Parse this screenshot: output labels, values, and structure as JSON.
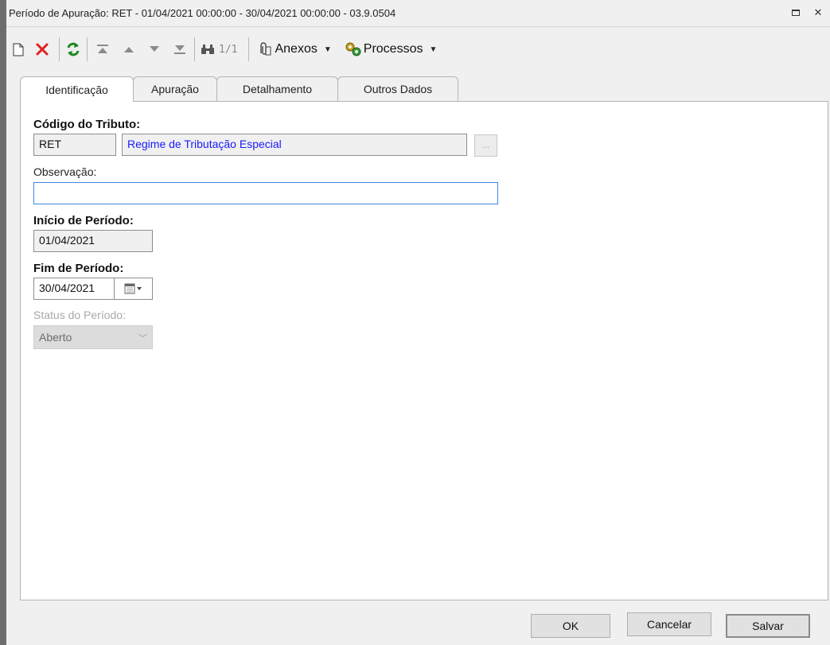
{
  "window": {
    "title": "Período de Apuração: RET - 01/04/2021 00:00:00 - 30/04/2021 00:00:00 - 03.9.0504"
  },
  "toolbar": {
    "new_icon": "new-document-icon",
    "delete_icon": "delete-icon",
    "refresh_icon": "refresh-icon",
    "counter": "1/1",
    "anexos_label": "Anexos",
    "processos_label": "Processos"
  },
  "tabs": [
    {
      "label": "Identificação",
      "active": true
    },
    {
      "label": "Apuração",
      "active": false
    },
    {
      "label": "Detalhamento",
      "active": false
    },
    {
      "label": "Outros Dados",
      "active": false
    }
  ],
  "form": {
    "codigo_label": "Código do Tributo:",
    "codigo_value": "RET",
    "codigo_desc": "Regime de Tributação Especial",
    "lookup_label": "...",
    "obs_label": "Observação:",
    "obs_value": "",
    "inicio_label": "Início de Período:",
    "inicio_value": "01/04/2021",
    "fim_label": "Fim de Período:",
    "fim_value": "30/04/2021",
    "status_label": "Status do Período:",
    "status_value": "Aberto"
  },
  "footer": {
    "ok_label": "OK",
    "cancel_label": "Cancelar",
    "save_label": "Salvar"
  },
  "colors": {
    "accent_blue": "#1a1aff",
    "focus_border": "#3f86d9",
    "delete_red": "#e02020",
    "refresh_green": "#1e8a1e"
  }
}
